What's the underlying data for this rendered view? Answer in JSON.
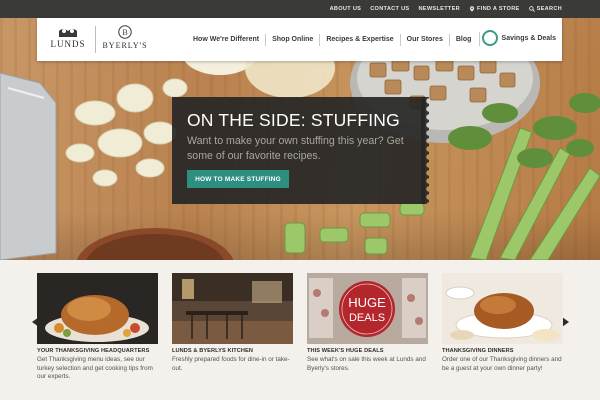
{
  "utility_links": [
    {
      "label": "ABOUT US",
      "icon": ""
    },
    {
      "label": "CONTACT US",
      "icon": ""
    },
    {
      "label": "NEWSLETTER",
      "icon": ""
    },
    {
      "label": "FIND A STORE",
      "icon": "location-pin-icon"
    },
    {
      "label": "SEARCH",
      "icon": "search-icon"
    }
  ],
  "brand": {
    "logo_left": "LUNDS",
    "logo_right": "BYERLY'S",
    "logo_right_mark": "B"
  },
  "nav": {
    "items": [
      "How We're Different",
      "Shop Online",
      "Recipes & Expertise",
      "Our Stores",
      "Blog"
    ],
    "savings_label": "Savings & Deals"
  },
  "promo": {
    "title": "ON THE SIDE: STUFFING",
    "body": "Want to make your own stuffing this year? Get some of our favorite recipes.",
    "cta": "HOW TO MAKE STUFFING"
  },
  "cards": [
    {
      "heading": "YOUR THANKSGIVING HEADQUARTERS",
      "text": "Get Thanksgiving menu ideas, see our turkey selection and get cooking tips from our experts."
    },
    {
      "heading": "LUNDS & BYERLYS KITCHEN",
      "text": "Freshly prepared foods for dine-in or take-out."
    },
    {
      "heading": "THIS WEEK'S HUGE DEALS",
      "text": "See what's on sale this week at Lunds and Byerly's stores.",
      "badge_line1": "HUGE",
      "badge_line2": "DEALS"
    },
    {
      "heading": "THANKSGIVING DINNERS",
      "text": "Order one of our Thanksgiving dinners and be a guest at your own dinner party!"
    }
  ],
  "colors": {
    "accent": "#2c8f80",
    "utility_bar": "#3a3a38",
    "promo_bg": "#262626",
    "deal_badge": "#b3262b"
  }
}
